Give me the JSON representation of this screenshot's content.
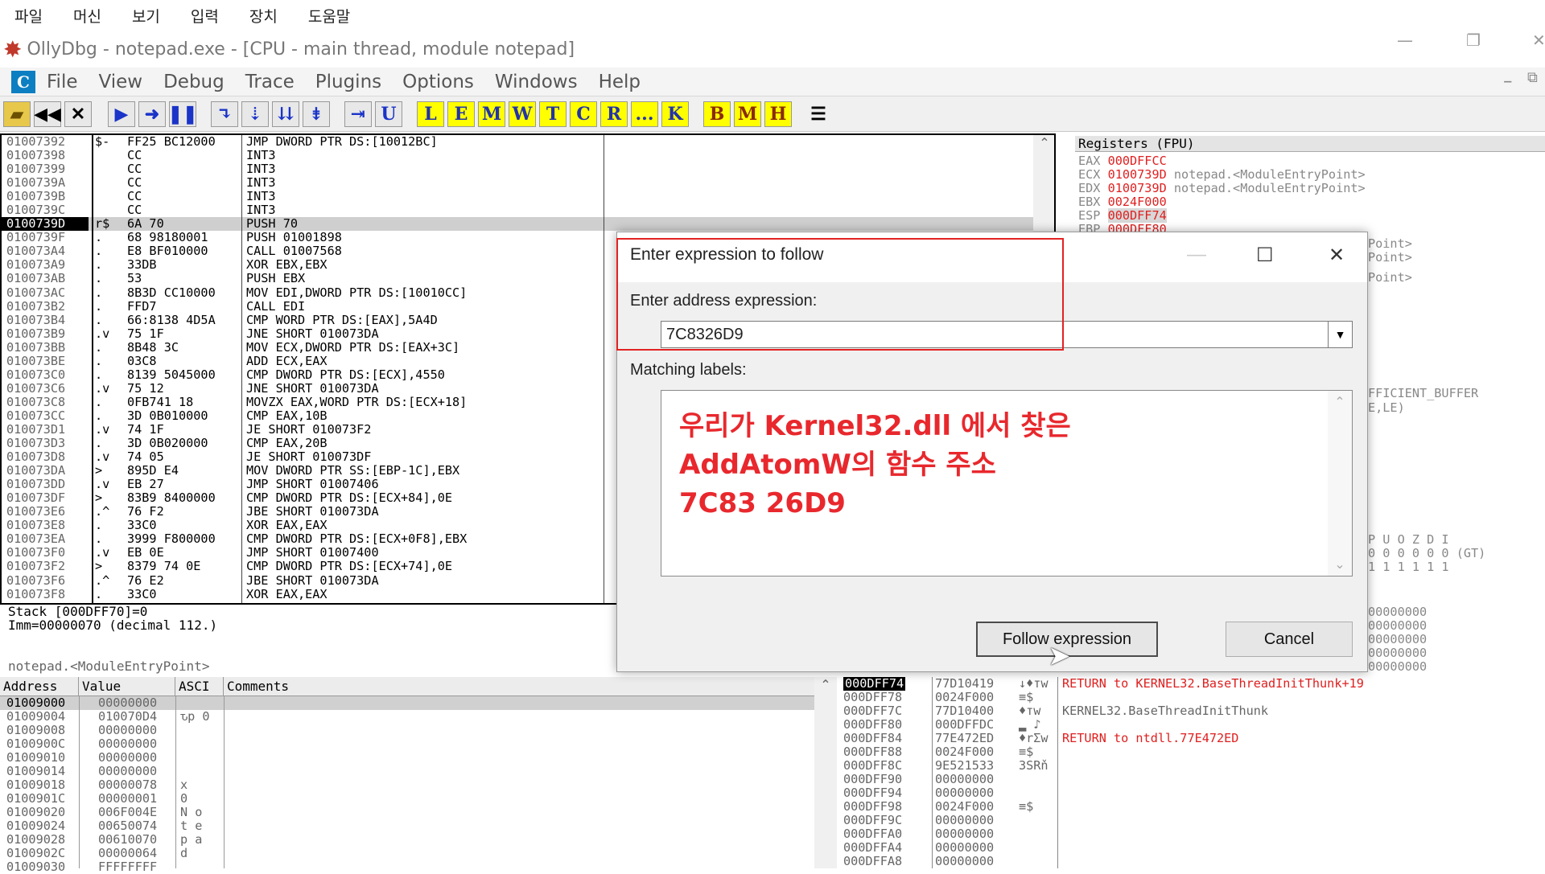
{
  "vbox_menu": [
    "파일",
    "머신",
    "보기",
    "입력",
    "장치",
    "도움말"
  ],
  "window": {
    "title": "OllyDbg - notepad.exe - [CPU - main thread, module notepad]"
  },
  "menu": [
    "File",
    "View",
    "Debug",
    "Trace",
    "Plugins",
    "Options",
    "Windows",
    "Help"
  ],
  "toolbar": {
    "letters": [
      "L",
      "E",
      "M",
      "W",
      "T",
      "C",
      "R",
      "...",
      "K",
      "B",
      "M",
      "H"
    ]
  },
  "cpu": {
    "addresses": [
      "01007392",
      "01007398",
      "01007399",
      "0100739A",
      "0100739B",
      "0100739C",
      "0100739D",
      "0100739F",
      "010073A4",
      "010073A9",
      "010073AB",
      "010073AC",
      "010073B2",
      "010073B4",
      "010073B9",
      "010073BB",
      "010073BE",
      "010073C0",
      "010073C6",
      "010073C8",
      "010073CC",
      "010073D1",
      "010073D3",
      "010073D8",
      "010073DA",
      "010073DD",
      "010073DF",
      "010073E6",
      "010073E8",
      "010073EA",
      "010073F0",
      "010073F2",
      "010073F6",
      "010073F8"
    ],
    "marks": [
      "$-",
      "",
      "",
      "",
      "",
      "",
      "r$",
      ". ",
      ". ",
      ". ",
      ". ",
      ". ",
      ". ",
      ". ",
      ".v",
      ". ",
      ". ",
      ". ",
      ".v",
      ". ",
      ". ",
      ".v",
      ". ",
      ".v",
      "> ",
      ".v",
      "> ",
      ".^",
      ". ",
      ". ",
      ".v",
      "> ",
      ".^",
      ". "
    ],
    "hex": [
      "FF25 BC12000",
      "CC",
      "CC",
      "CC",
      "CC",
      "CC",
      "6A 70",
      "68 98180001",
      "E8 BF010000",
      "33DB",
      "53",
      "8B3D CC10000",
      "FFD7",
      "66:8138 4D5A",
      "75 1F",
      "8B48 3C",
      "03C8",
      "8139 5045000",
      "75 12",
      "0FB741 18",
      "3D 0B010000",
      "74 1F",
      "3D 0B020000",
      "74 05",
      "895D E4",
      "EB 27",
      "83B9 8400000",
      "76 F2",
      "33C0",
      "3999 F800000",
      "EB 0E",
      "8379 74 0E",
      "76 E2",
      "33C0"
    ],
    "asm": [
      "JMP DWORD PTR DS:[10012BC]",
      "INT3",
      "INT3",
      "INT3",
      "INT3",
      "INT3",
      "PUSH 70",
      "PUSH 01001898",
      "CALL 01007568",
      "XOR EBX,EBX",
      "PUSH EBX",
      "MOV EDI,DWORD PTR DS:[10010CC]",
      "CALL EDI",
      "CMP WORD PTR DS:[EAX],5A4D",
      "JNE SHORT 010073DA",
      "MOV ECX,DWORD PTR DS:[EAX+3C]",
      "ADD ECX,EAX",
      "CMP DWORD PTR DS:[ECX],4550",
      "JNE SHORT 010073DA",
      "MOVZX EAX,WORD PTR DS:[ECX+18]",
      "CMP EAX,10B",
      "JE SHORT 010073F2",
      "CMP EAX,20B",
      "JE SHORT 010073DF",
      "MOV DWORD PTR SS:[EBP-1C],EBX",
      "JMP SHORT 01007406",
      "CMP DWORD PTR DS:[ECX+84],0E",
      "JBE SHORT 010073DA",
      "XOR EAX,EAX",
      "CMP DWORD PTR DS:[ECX+0F8],EBX",
      "JMP SHORT 01007400",
      "CMP DWORD PTR DS:[ECX+74],0E",
      "JBE SHORT 010073DA",
      "XOR EAX,EAX"
    ]
  },
  "registers": {
    "header": "Registers (FPU)",
    "rows": [
      {
        "n": "EAX",
        "v": "000DFFCC",
        "c": ""
      },
      {
        "n": "ECX",
        "v": "0100739D",
        "c": "notepad.<ModuleEntryPoint>"
      },
      {
        "n": "EDX",
        "v": "0100739D",
        "c": "notepad.<ModuleEntryPoint>"
      },
      {
        "n": "EBX",
        "v": "0024F000",
        "c": ""
      },
      {
        "n": "ESP",
        "v": "000DFF74",
        "c": ""
      },
      {
        "n": "EBP",
        "v": "000DFF80",
        "c": ""
      }
    ],
    "partial": [
      "Point>",
      "Point>",
      "Point>",
      "FFICIENT_BUFFER",
      "E,LE)",
      "P U O Z D I",
      "0 0 0 0 0 0 (GT)",
      "1 1 1 1 1 1",
      "00000000",
      "00000000",
      "00000000",
      "00000000",
      "00000000"
    ]
  },
  "info": {
    "line1": "Stack [000DFF70]=0",
    "line2": "Imm=00000070 (decimal 112.)",
    "line3": "notepad.<ModuleEntryPoint>"
  },
  "dump": {
    "headers": [
      "Address",
      "Value",
      "ASCI",
      "Comments"
    ],
    "rows": [
      [
        "01009000",
        "00000000",
        ""
      ],
      [
        "01009004",
        "010070D4",
        "ԏp 0"
      ],
      [
        "01009008",
        "00000000",
        ""
      ],
      [
        "0100900C",
        "00000000",
        ""
      ],
      [
        "01009010",
        "00000000",
        ""
      ],
      [
        "01009014",
        "00000000",
        ""
      ],
      [
        "01009018",
        "00000078",
        "x"
      ],
      [
        "0100901C",
        "00000001",
        "0"
      ],
      [
        "01009020",
        "006F004E",
        "N o"
      ],
      [
        "01009024",
        "00650074",
        "t e"
      ],
      [
        "01009028",
        "00610070",
        "p a"
      ],
      [
        "0100902C",
        "00000064",
        "d"
      ],
      [
        "01009030",
        "FFFFFFFF",
        ""
      ]
    ]
  },
  "stack": {
    "rows": [
      [
        "000DFF74",
        "77D10419",
        "↓♦тw",
        "RETURN to KERNEL32.BaseThreadInitThunk+19"
      ],
      [
        "000DFF78",
        "0024F000",
        "≡$",
        ""
      ],
      [
        "000DFF7C",
        "77D10400",
        "♦тw",
        "KERNEL32.BaseThreadInitThunk"
      ],
      [
        "000DFF80",
        "000DFFDC",
        "▂ ♪",
        ""
      ],
      [
        "000DFF84",
        "77E472ED",
        "♦rΣw",
        "RETURN to ntdll.77E472ED"
      ],
      [
        "000DFF88",
        "0024F000",
        "≡$",
        ""
      ],
      [
        "000DFF8C",
        "9E521533",
        "3SRň",
        ""
      ],
      [
        "000DFF90",
        "00000000",
        "",
        ""
      ],
      [
        "000DFF94",
        "00000000",
        "",
        ""
      ],
      [
        "000DFF98",
        "0024F000",
        "≡$",
        ""
      ],
      [
        "000DFF9C",
        "00000000",
        "",
        ""
      ],
      [
        "000DFFA0",
        "00000000",
        "",
        ""
      ],
      [
        "000DFFA4",
        "00000000",
        "",
        ""
      ],
      [
        "000DFFA8",
        "00000000",
        "",
        ""
      ]
    ]
  },
  "dialog": {
    "title": "Enter expression to follow",
    "address_label": "Enter address expression:",
    "address_value": "7C8326D9",
    "labels_label": "Matching labels:",
    "annotation": [
      "우리가 Kernel32.dll 에서 찾은",
      "AddAtomW의 함수 주소",
      "7C83 26D9"
    ],
    "follow_button": "Follow expression",
    "cancel_button": "Cancel"
  },
  "colors": {
    "annotation": "#e8282d",
    "redbox": "#e32222",
    "stack_return": "#e02020",
    "register_changed": "#e02020"
  }
}
